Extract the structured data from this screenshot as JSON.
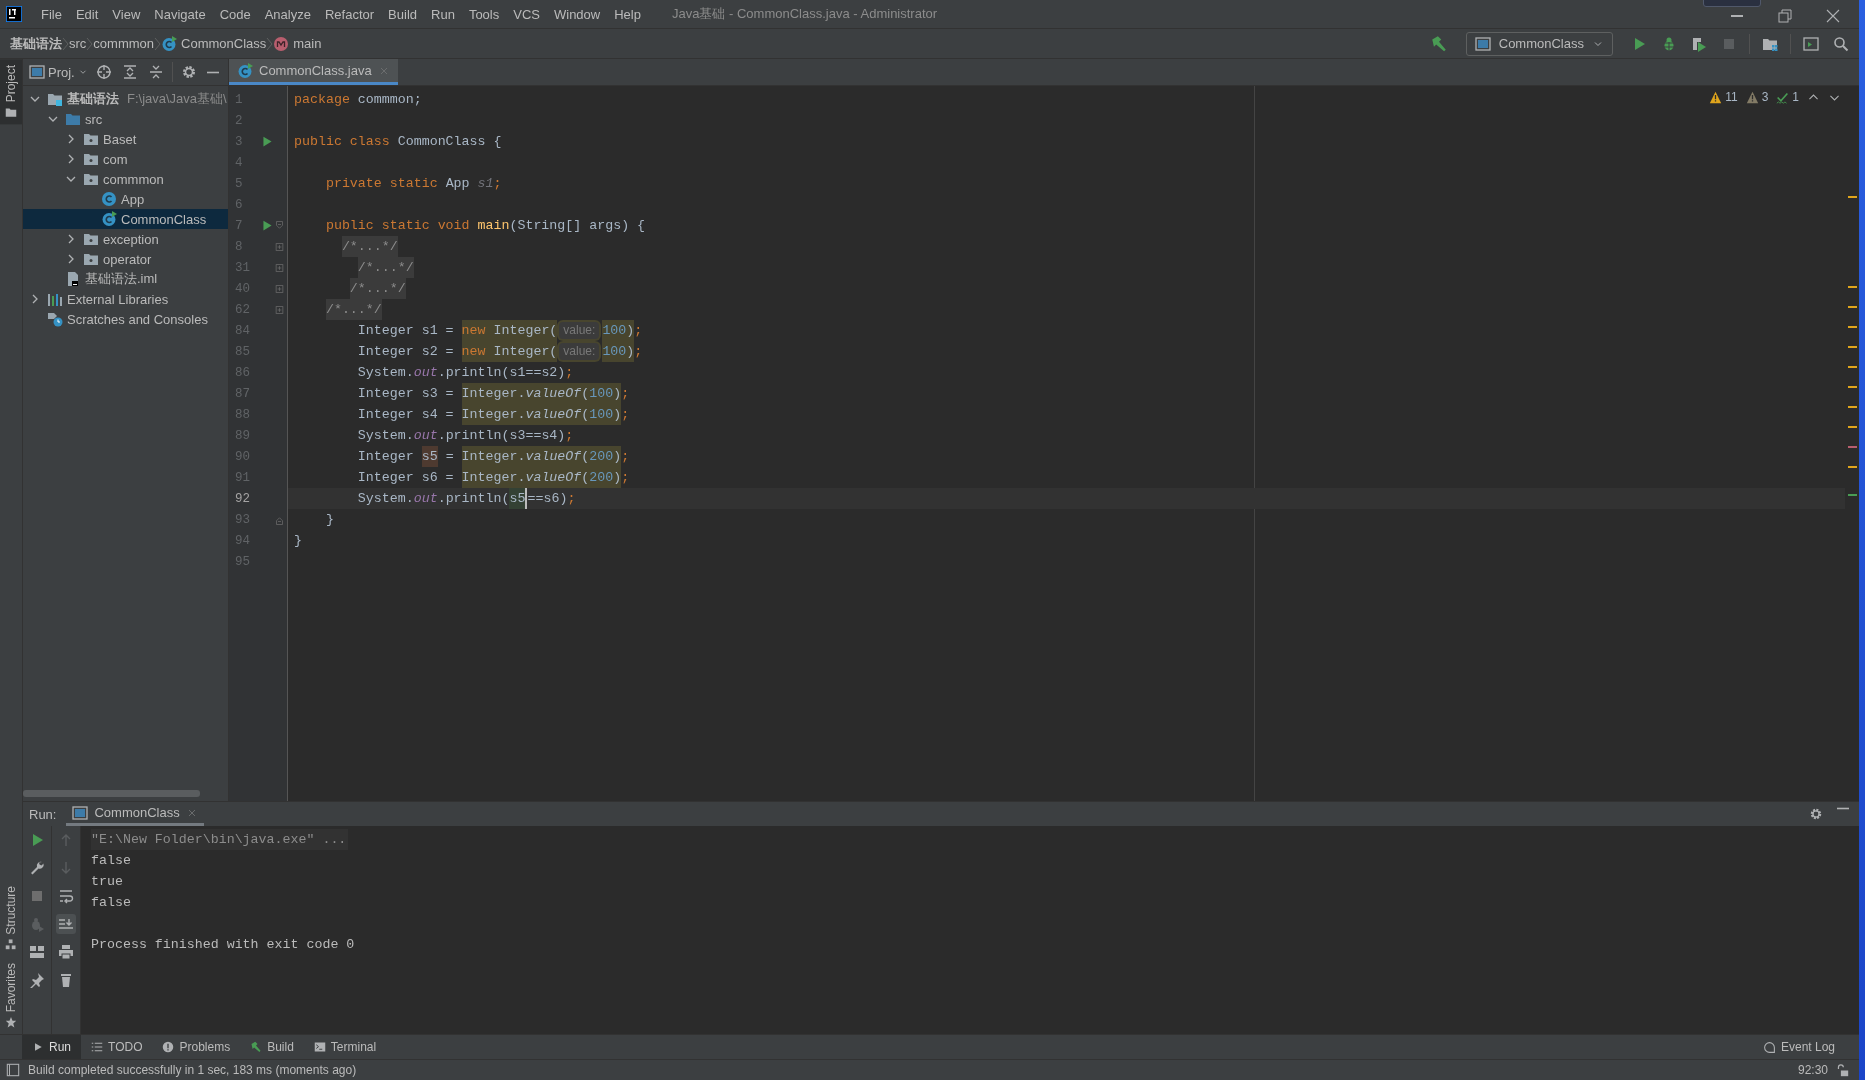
{
  "window": {
    "title": "Java基础 - CommonClass.java - Administrator"
  },
  "menu": [
    "File",
    "Edit",
    "View",
    "Navigate",
    "Code",
    "Analyze",
    "Refactor",
    "Build",
    "Run",
    "Tools",
    "VCS",
    "Window",
    "Help"
  ],
  "breadcrumbs": [
    {
      "label": "基础语法",
      "kind": "module"
    },
    {
      "label": "src",
      "kind": "folder"
    },
    {
      "label": "commmon",
      "kind": "folder"
    },
    {
      "label": "CommonClass",
      "kind": "class"
    },
    {
      "label": "main",
      "kind": "method"
    }
  ],
  "run_config": {
    "label": "CommonClass"
  },
  "side_tabs": [
    {
      "label": "Project",
      "selected": true
    },
    {
      "label": "Structure",
      "selected": false
    },
    {
      "label": "Favorites",
      "selected": false
    }
  ],
  "project": {
    "title": "Proj.",
    "tree": [
      {
        "label": "基础语法",
        "detail": "F:\\java\\Java基础\\",
        "kind": "module",
        "expanded": true,
        "selected": false,
        "children": [
          {
            "label": "src",
            "kind": "source",
            "expanded": true,
            "selected": false,
            "children": [
              {
                "label": "Baset",
                "kind": "package",
                "expanded": false,
                "selected": false
              },
              {
                "label": "com",
                "kind": "package",
                "expanded": false,
                "selected": false
              },
              {
                "label": "commmon",
                "kind": "package",
                "expanded": true,
                "selected": false,
                "children": [
                  {
                    "label": "App",
                    "kind": "class",
                    "selected": false
                  },
                  {
                    "label": "CommonClass",
                    "kind": "runnable-class",
                    "selected": true
                  }
                ]
              },
              {
                "label": "exception",
                "kind": "package",
                "expanded": false,
                "selected": false
              },
              {
                "label": "operator",
                "kind": "package",
                "expanded": false,
                "selected": false
              }
            ]
          },
          {
            "label": "基础语法.iml",
            "kind": "file",
            "selected": false
          }
        ]
      },
      {
        "label": "External Libraries",
        "kind": "libraries",
        "expanded": false,
        "selected": false
      },
      {
        "label": "Scratches and Consoles",
        "kind": "scratches",
        "selected": false
      }
    ]
  },
  "editor": {
    "tabs": [
      {
        "label": "CommonClass.java",
        "selected": true
      }
    ],
    "inspections": [
      {
        "kind": "warning",
        "count": "11"
      },
      {
        "kind": "weak-warning",
        "count": "3"
      },
      {
        "kind": "typo",
        "count": "1"
      }
    ],
    "lines": [
      {
        "number": "1",
        "run": false,
        "current": false,
        "code": [
          {
            "text": "package ",
            "kind": "keyword"
          },
          {
            "text": "commmon;",
            "kind": "text"
          }
        ]
      },
      {
        "number": "2",
        "run": false,
        "current": false
      },
      {
        "number": "3",
        "run": true,
        "current": false,
        "code": [
          {
            "text": "public class ",
            "kind": "keyword"
          },
          {
            "text": "CommonClass {",
            "kind": "text"
          }
        ]
      },
      {
        "number": "4",
        "run": false,
        "current": false
      },
      {
        "number": "5",
        "run": false,
        "current": false,
        "code": [
          {
            "text": "    private static ",
            "kind": "keyword"
          },
          {
            "text": "App ",
            "kind": "text"
          },
          {
            "text": "s1",
            "kind": "unused"
          },
          {
            "text": ";",
            "kind": "keyword"
          }
        ]
      },
      {
        "number": "6",
        "run": false,
        "current": false
      },
      {
        "number": "7",
        "run": true,
        "current": false,
        "fold": {
          "kind": "open"
        },
        "code": [
          {
            "text": "    public static void ",
            "kind": "keyword"
          },
          {
            "text": "main",
            "kind": "method"
          },
          {
            "text": "(String[] args) {",
            "kind": "text"
          }
        ]
      },
      {
        "number": "8",
        "run": false,
        "current": false,
        "fold": {
          "kind": "collapsed"
        },
        "code": [
          {
            "text": "      /*...*/",
            "kind": "folded"
          }
        ]
      },
      {
        "number": "31",
        "run": false,
        "current": false,
        "fold": {
          "kind": "collapsed"
        },
        "code": [
          {
            "text": "        /*...*/",
            "kind": "folded"
          }
        ]
      },
      {
        "number": "40",
        "run": false,
        "current": false,
        "fold": {
          "kind": "collapsed"
        },
        "code": [
          {
            "text": "       /*...*/",
            "kind": "folded"
          }
        ]
      },
      {
        "number": "62",
        "run": false,
        "current": false,
        "fold": {
          "kind": "collapsed"
        },
        "code": [
          {
            "text": "    /*...*/",
            "kind": "folded"
          }
        ]
      },
      {
        "number": "84",
        "run": false,
        "current": false,
        "code": [
          {
            "text": "        Integer s1 = ",
            "kind": "text"
          },
          {
            "text": "new ",
            "kind": "keyword",
            "highlight": {
              "kind": "match"
            }
          },
          {
            "text": "Integer(",
            "kind": "text",
            "highlight": {
              "kind": "match"
            }
          },
          {
            "text": "value:",
            "kind": "hint",
            "highlight": {
              "kind": "match"
            }
          },
          {
            "text": "100",
            "kind": "number",
            "highlight": {
              "kind": "match"
            }
          },
          {
            "text": ")",
            "kind": "text",
            "highlight": {
              "kind": "match"
            }
          },
          {
            "text": ";",
            "kind": "keyword"
          }
        ]
      },
      {
        "number": "85",
        "run": false,
        "current": false,
        "code": [
          {
            "text": "        Integer s2 = ",
            "kind": "text"
          },
          {
            "text": "new ",
            "kind": "keyword",
            "highlight": {
              "kind": "match"
            }
          },
          {
            "text": "Integer(",
            "kind": "text",
            "highlight": {
              "kind": "match"
            }
          },
          {
            "text": "value:",
            "kind": "hint",
            "highlight": {
              "kind": "match"
            }
          },
          {
            "text": "100",
            "kind": "number",
            "highlight": {
              "kind": "match"
            }
          },
          {
            "text": ")",
            "kind": "text",
            "highlight": {
              "kind": "match"
            }
          },
          {
            "text": ";",
            "kind": "keyword"
          }
        ]
      },
      {
        "number": "86",
        "run": false,
        "current": false,
        "code": [
          {
            "text": "        System.",
            "kind": "text"
          },
          {
            "text": "out",
            "kind": "static"
          },
          {
            "text": ".println(s1==s2)",
            "kind": "text"
          },
          {
            "text": ";",
            "kind": "keyword"
          }
        ]
      },
      {
        "number": "87",
        "run": false,
        "current": false,
        "code": [
          {
            "text": "        Integer s3 = ",
            "kind": "text"
          },
          {
            "text": "Integer.",
            "kind": "text",
            "highlight": {
              "kind": "match"
            }
          },
          {
            "text": "valueOf",
            "kind": "italic",
            "highlight": {
              "kind": "match"
            }
          },
          {
            "text": "(",
            "kind": "text",
            "highlight": {
              "kind": "match"
            }
          },
          {
            "text": "100",
            "kind": "number",
            "highlight": {
              "kind": "match"
            }
          },
          {
            "text": ")",
            "kind": "text",
            "highlight": {
              "kind": "match"
            }
          },
          {
            "text": ";",
            "kind": "keyword"
          }
        ]
      },
      {
        "number": "88",
        "run": false,
        "current": false,
        "code": [
          {
            "text": "        Integer s4 = ",
            "kind": "text"
          },
          {
            "text": "Integer.",
            "kind": "text",
            "highlight": {
              "kind": "match"
            }
          },
          {
            "text": "valueOf",
            "kind": "italic",
            "highlight": {
              "kind": "match"
            }
          },
          {
            "text": "(",
            "kind": "text",
            "highlight": {
              "kind": "match"
            }
          },
          {
            "text": "100",
            "kind": "number",
            "highlight": {
              "kind": "match"
            }
          },
          {
            "text": ")",
            "kind": "text",
            "highlight": {
              "kind": "match"
            }
          },
          {
            "text": ";",
            "kind": "keyword"
          }
        ]
      },
      {
        "number": "89",
        "run": false,
        "current": false,
        "code": [
          {
            "text": "        System.",
            "kind": "text"
          },
          {
            "text": "out",
            "kind": "static"
          },
          {
            "text": ".println(s3==s4)",
            "kind": "text"
          },
          {
            "text": ";",
            "kind": "keyword"
          }
        ]
      },
      {
        "number": "90",
        "run": false,
        "current": false,
        "code": [
          {
            "text": "        Integer ",
            "kind": "text"
          },
          {
            "text": "s5",
            "kind": "text",
            "highlight": {
              "kind": "write"
            }
          },
          {
            "text": " = ",
            "kind": "text"
          },
          {
            "text": "Integer.",
            "kind": "text",
            "highlight": {
              "kind": "match"
            }
          },
          {
            "text": "valueOf",
            "kind": "italic",
            "highlight": {
              "kind": "match"
            }
          },
          {
            "text": "(",
            "kind": "text",
            "highlight": {
              "kind": "match"
            }
          },
          {
            "text": "200",
            "kind": "number",
            "highlight": {
              "kind": "match"
            }
          },
          {
            "text": ")",
            "kind": "text",
            "highlight": {
              "kind": "match"
            }
          },
          {
            "text": ";",
            "kind": "keyword"
          }
        ]
      },
      {
        "number": "91",
        "run": false,
        "current": false,
        "code": [
          {
            "text": "        Integer s6 = ",
            "kind": "text"
          },
          {
            "text": "Integer.",
            "kind": "text",
            "highlight": {
              "kind": "match"
            }
          },
          {
            "text": "valueOf",
            "kind": "italic",
            "highlight": {
              "kind": "match"
            }
          },
          {
            "text": "(",
            "kind": "text",
            "highlight": {
              "kind": "match"
            }
          },
          {
            "text": "200",
            "kind": "number",
            "highlight": {
              "kind": "match"
            }
          },
          {
            "text": ")",
            "kind": "text",
            "highlight": {
              "kind": "match"
            }
          },
          {
            "text": ";",
            "kind": "keyword"
          }
        ]
      },
      {
        "number": "92",
        "run": false,
        "current": true,
        "code": [
          {
            "text": "        System.",
            "kind": "text"
          },
          {
            "text": "out",
            "kind": "static"
          },
          {
            "text": ".println(",
            "kind": "text"
          },
          {
            "text": "s5",
            "kind": "text",
            "highlight": {
              "kind": "read"
            }
          },
          {
            "text": "==",
            "kind": "text",
            "caret": true
          },
          {
            "text": "s6)",
            "kind": "text"
          },
          {
            "text": ";",
            "kind": "keyword"
          }
        ]
      },
      {
        "number": "93",
        "run": false,
        "current": false,
        "fold": {
          "kind": "end"
        },
        "code": [
          {
            "text": "    }",
            "kind": "text"
          }
        ]
      },
      {
        "number": "94",
        "run": false,
        "current": false,
        "code": [
          {
            "text": "}",
            "kind": "text"
          }
        ]
      },
      {
        "number": "95",
        "run": false,
        "current": false
      }
    ]
  },
  "run_panel": {
    "label": "Run:",
    "tabs": [
      {
        "label": "CommonClass",
        "selected": true
      }
    ],
    "console": [
      {
        "text": "\"E:\\New Folder\\bin\\java.exe\" ...",
        "kind": "command"
      },
      {
        "text": "false",
        "kind": "output"
      },
      {
        "text": "true",
        "kind": "output"
      },
      {
        "text": "false",
        "kind": "output"
      },
      {
        "text": "Process finished with exit code 0",
        "kind": "exit"
      }
    ]
  },
  "tool_tabs": [
    {
      "label": "Run",
      "selected": true
    },
    {
      "label": "TODO",
      "selected": false
    },
    {
      "label": "Problems",
      "selected": false
    },
    {
      "label": "Build",
      "selected": false
    },
    {
      "label": "Terminal",
      "selected": false
    }
  ],
  "event_log": {
    "label": "Event Log"
  },
  "status_bar": {
    "message": "Build completed successfully in 1 sec, 183 ms (moments ago)",
    "position": "92:30"
  }
}
